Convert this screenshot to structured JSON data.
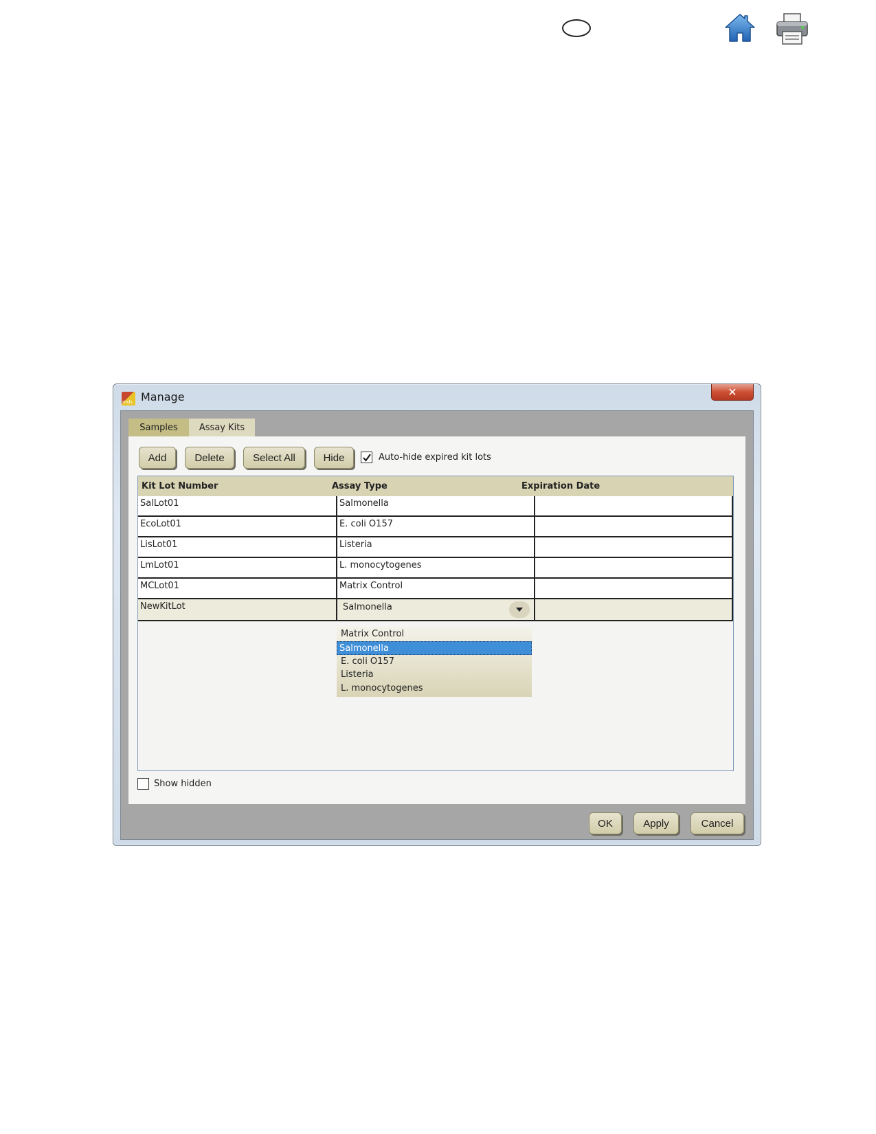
{
  "page_icons": {
    "oval": "oval-icon",
    "home": "home-icon",
    "print": "printer-icon"
  },
  "window": {
    "title": "Manage",
    "app_icon_text": "mds",
    "close_glyph": "✕"
  },
  "tabs": [
    {
      "label": "Samples",
      "active": true
    },
    {
      "label": "Assay Kits",
      "active": false
    }
  ],
  "toolbar": {
    "add_label": "Add",
    "delete_label": "Delete",
    "select_all_label": "Select All",
    "hide_label": "Hide",
    "auto_hide_label": "Auto-hide expired kit lots",
    "auto_hide_checked": true
  },
  "grid": {
    "columns": [
      "Kit Lot Number",
      "Assay Type",
      "Expiration Date"
    ],
    "rows": [
      {
        "lot": "SalLot01",
        "assay": "Salmonella",
        "expiration": ""
      },
      {
        "lot": "EcoLot01",
        "assay": "E. coli O157",
        "expiration": ""
      },
      {
        "lot": "LisLot01",
        "assay": "Listeria",
        "expiration": ""
      },
      {
        "lot": "LmLot01",
        "assay": "L. monocytogenes",
        "expiration": ""
      },
      {
        "lot": "MCLot01",
        "assay": "Matrix Control",
        "expiration": ""
      }
    ],
    "editing_row": {
      "lot": "NewKitLot",
      "assay": "Salmonella",
      "expiration": ""
    },
    "dropdown_options": [
      "Matrix Control",
      "Salmonella",
      "E. coli O157",
      "Listeria",
      "L. monocytogenes"
    ],
    "dropdown_selected": "Salmonella"
  },
  "show_hidden": {
    "label": "Show hidden",
    "checked": false
  },
  "dialog_buttons": {
    "ok": "OK",
    "apply": "Apply",
    "cancel": "Cancel"
  },
  "colors": {
    "tab_active": "#c4bd86",
    "tab_inactive": "#dedac0",
    "grid_header": "#d8d3b3",
    "selection": "#3f8ed8",
    "close_button": "#cd4f34",
    "icon_blue": "#2e78c7"
  }
}
